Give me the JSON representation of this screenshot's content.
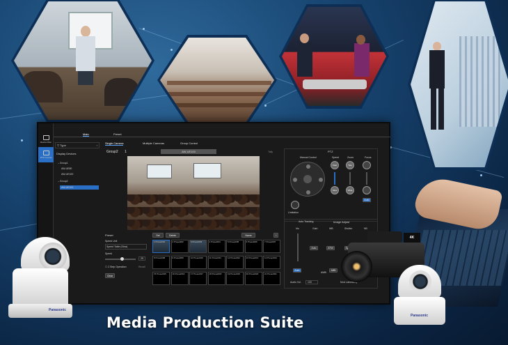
{
  "caption": "Media Production Suite",
  "brand": "Panasonic",
  "sidebar": {
    "items": [
      {
        "label": "Device Disc",
        "icon": "monitor-icon"
      },
      {
        "label": "PTZ Control",
        "icon": "camera-icon"
      }
    ]
  },
  "tabs": {
    "main": "Main",
    "preset": "Preset"
  },
  "sub_tabs": [
    "Single Camera",
    "Multiple Cameras",
    "Group Control"
  ],
  "filter": {
    "type_label": "Type",
    "display_devices": "Display Devices"
  },
  "groups": [
    {
      "label": "Group1",
      "devices": [
        "AW-UE80",
        "AW-UE100"
      ]
    },
    {
      "label": "Group2",
      "devices": [
        "AW-UE100"
      ]
    }
  ],
  "header": {
    "group": "Group2",
    "index": "1",
    "camera_name": "AW-UE100",
    "tally": "Tally"
  },
  "ptz_panel": {
    "title": "PTZ",
    "manual_control": "Manual Control",
    "speed": "Speed",
    "zoom": "Zoom",
    "focus": "Focus",
    "fast": "Fast",
    "tele": "Tele",
    "slow": "Slow",
    "wide": "Wide",
    "auto": "Auto",
    "limitation": "Limitation"
  },
  "image_adjust": {
    "auto_tracking": "Auto Tracking",
    "title": "Image Adjust",
    "iris": "Iris",
    "gain": "Gain",
    "wb": "WB",
    "shutter": "Shutter",
    "nd": "ND",
    "auto_label": "Auto",
    "atw": "ATW",
    "awb": "AWB",
    "abb": "ABB",
    "synchro": "Synchro",
    "audio_vol": "Audio Vol.",
    "audio_value": "100",
    "mod_label": "Mod Laboratory"
  },
  "preset_panel": {
    "title": "Preset",
    "speed_unit": "Speed Unit",
    "speed_unit_value": "Speed Table (Slow)",
    "speed": "Speed",
    "speed_value": "25",
    "step_operation": "2 Step Operation",
    "recall": "Recall",
    "clear": "Clear",
    "set": "Set",
    "delete": "Delete",
    "name": "Name",
    "cells": [
      "Preset001",
      "Preset002",
      "Preset003",
      "Preset004",
      "Preset005",
      "Preset006",
      "Preset007",
      "Preset008",
      "Preset009",
      "Preset010",
      "Preset011",
      "Preset012",
      "Preset013",
      "Preset014",
      "Preset015",
      "Preset016",
      "Preset017",
      "Preset018",
      "Preset019",
      "Preset020",
      "Preset021"
    ],
    "cell_numbers": [
      "1",
      "2",
      "3",
      "4",
      "5",
      "6",
      "7",
      "8",
      "9",
      "10",
      "11",
      "12",
      "13",
      "14",
      "15",
      "16",
      "17",
      "18",
      "19",
      "20",
      "21"
    ]
  },
  "colors": {
    "accent": "#2a6fc6",
    "background": "#174470",
    "window": "#1a1a1a"
  }
}
